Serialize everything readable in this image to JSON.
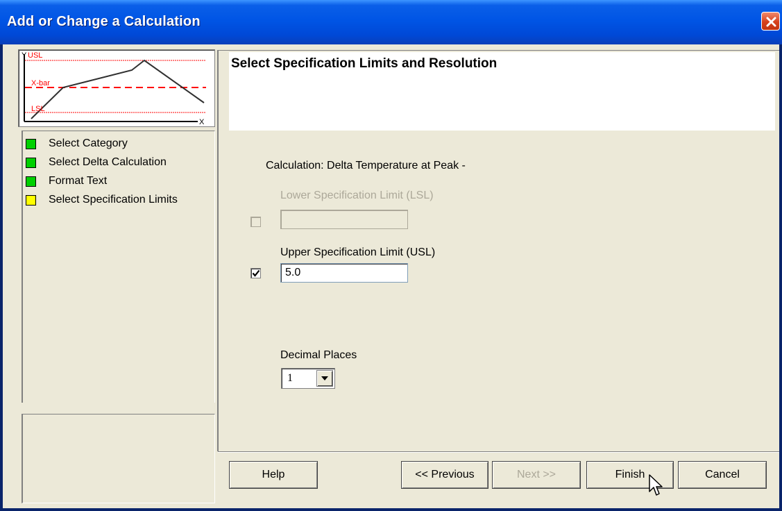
{
  "window": {
    "title": "Add or Change a Calculation"
  },
  "thumbnail": {
    "y_axis": "Y",
    "usl": "USL",
    "xbar": "X-bar",
    "lsl": "LSL",
    "x_axis": "X",
    "limit_color": "#ff0000",
    "line_color": "#000000"
  },
  "steps": [
    {
      "label": "Select Category",
      "status_color": "#00d000"
    },
    {
      "label": "Select Delta Calculation",
      "status_color": "#00d000"
    },
    {
      "label": "Format Text",
      "status_color": "#00d000"
    },
    {
      "label": "Select Specification Limits",
      "status_color": "#ffff00"
    }
  ],
  "header": {
    "title": "Select Specification Limits and Resolution"
  },
  "form": {
    "calculation_label": "Calculation: Delta Temperature at Peak -",
    "lsl": {
      "label": "Lower Specification Limit (LSL)",
      "checked": false,
      "value": ""
    },
    "usl": {
      "label": "Upper Specification Limit (USL)",
      "checked": true,
      "value": "5.0"
    },
    "decimal_places": {
      "label": "Decimal Places",
      "value": "1"
    }
  },
  "buttons": {
    "help": "Help",
    "previous": "<< Previous",
    "next": "Next >>",
    "finish": "Finish",
    "cancel": "Cancel"
  }
}
